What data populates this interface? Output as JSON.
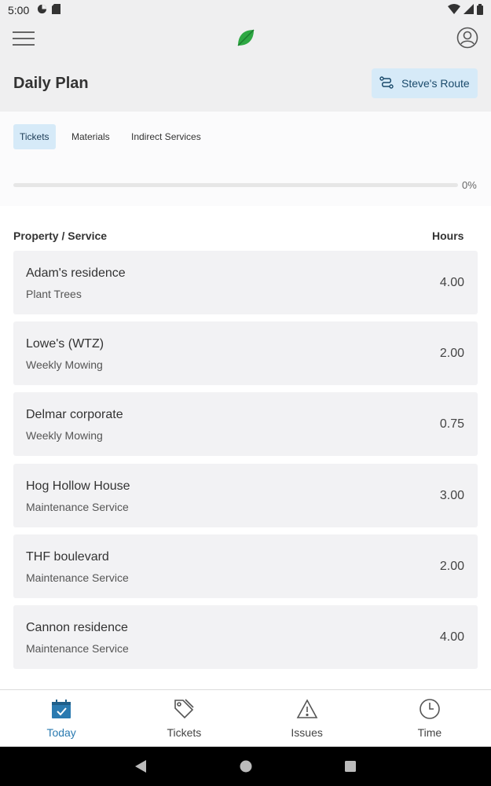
{
  "status_bar": {
    "time": "5:00"
  },
  "header": {
    "title": "Daily Plan",
    "route_button_label": "Steve's Route"
  },
  "tabs": [
    {
      "label": "Tickets",
      "active": true
    },
    {
      "label": "Materials",
      "active": false
    },
    {
      "label": "Indirect Services",
      "active": false
    }
  ],
  "progress": {
    "value": 0,
    "label": "0%"
  },
  "columns": {
    "property": "Property / Service",
    "hours": "Hours"
  },
  "items": [
    {
      "property": "Adam's residence",
      "service": "Plant Trees",
      "hours": "4.00"
    },
    {
      "property": "Lowe's (WTZ)",
      "service": "Weekly Mowing",
      "hours": "2.00"
    },
    {
      "property": "Delmar corporate",
      "service": "Weekly Mowing",
      "hours": "0.75"
    },
    {
      "property": "Hog Hollow House",
      "service": "Maintenance Service",
      "hours": "3.00"
    },
    {
      "property": "THF boulevard",
      "service": "Maintenance Service",
      "hours": "2.00"
    },
    {
      "property": "Cannon residence",
      "service": "Maintenance Service",
      "hours": "4.00"
    }
  ],
  "bottom_nav": [
    {
      "label": "Today",
      "icon": "calendar-icon",
      "active": true
    },
    {
      "label": "Tickets",
      "icon": "tag-icon",
      "active": false
    },
    {
      "label": "Issues",
      "icon": "warning-icon",
      "active": false
    },
    {
      "label": "Time",
      "icon": "clock-icon",
      "active": false
    }
  ],
  "colors": {
    "accent": "#2a7ab0",
    "active_tab_bg": "#d6eaf8",
    "logo_green": "#2ea843",
    "card_bg": "#f2f2f4"
  }
}
